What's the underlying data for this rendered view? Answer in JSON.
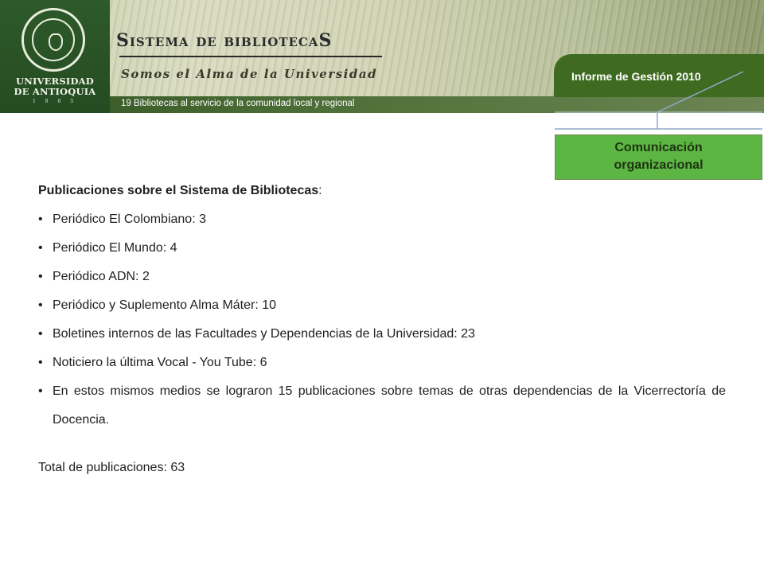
{
  "banner": {
    "university_line1": "UNIVERSIDAD",
    "university_line2": "DE ANTIOQUIA",
    "university_year": "1 8 0 3",
    "system_title": "Sistema de bibliotecaS",
    "system_subtitle": "Somos el Alma de la Universidad",
    "strip_text": "19 Bibliotecas al servicio de la comunidad local y regional",
    "report_label": "Informe de Gestión 2010"
  },
  "section": {
    "line1": "Comunicación",
    "line2": "organizacional"
  },
  "content": {
    "heading_bold": "Publicaciones sobre el Sistema de Bibliotecas",
    "heading_suffix": ":",
    "items": [
      "Periódico El Colombiano: 3",
      "Periódico El Mundo: 4",
      "Periódico ADN: 2",
      "Periódico y Suplemento Alma Máter: 10",
      "Boletines internos de las Facultades y Dependencias de la Universidad: 23",
      "Noticiero la última Vocal - You Tube: 6",
      "En estos mismos medios se lograron 15 publicaciones sobre temas de otras dependencias de la Vicerrectoría de Docencia."
    ],
    "total": "Total de publicaciones: 63"
  },
  "colors": {
    "banner_green": "#3f6b21",
    "section_box_green": "#5db544",
    "connector_blue": "#8ea9c8"
  }
}
